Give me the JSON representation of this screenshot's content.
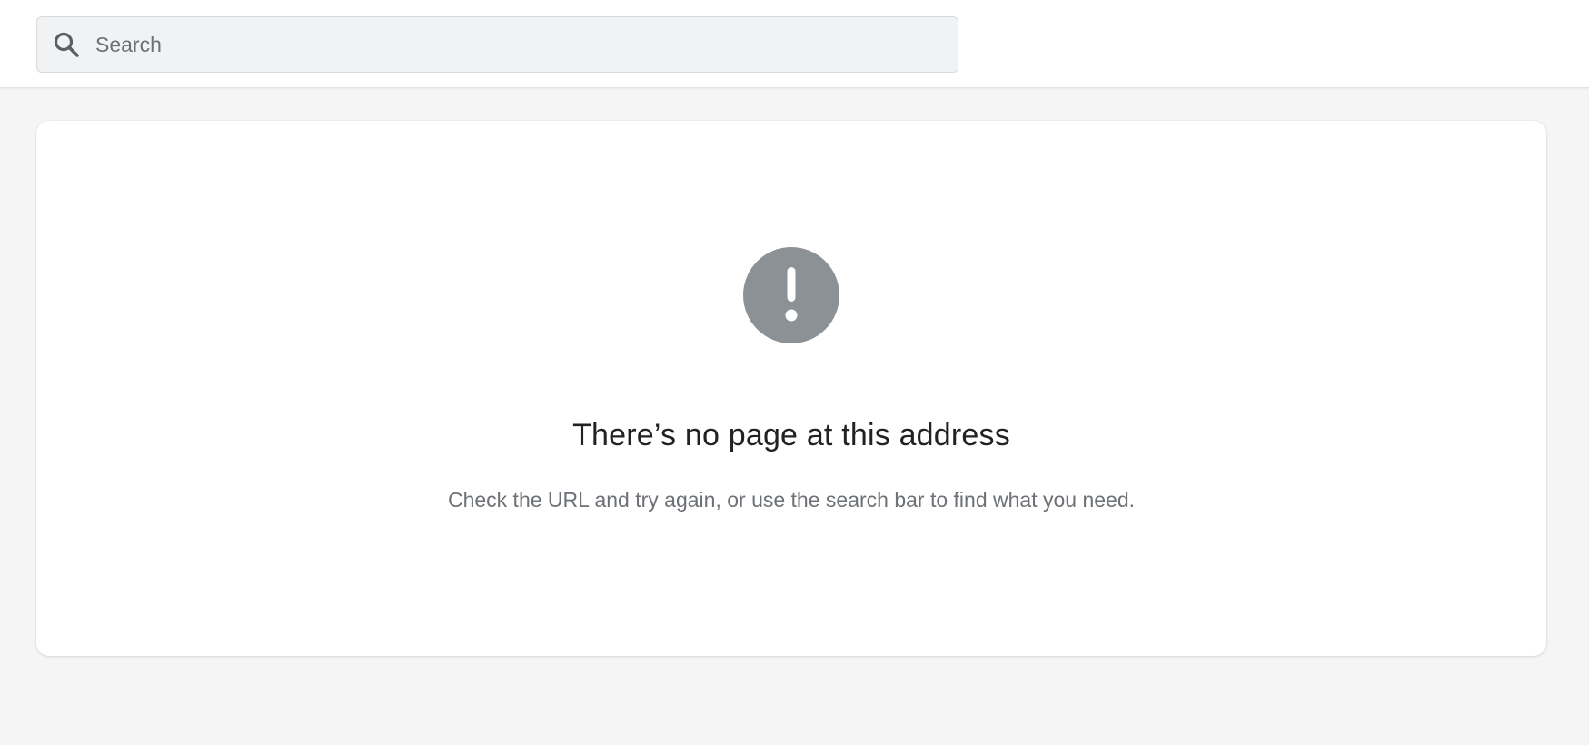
{
  "search": {
    "placeholder": "Search",
    "icon": "search-icon"
  },
  "error": {
    "icon": "exclamation-circle-icon",
    "icon_color": "#8c9196",
    "title": "There’s no page at this address",
    "message": "Check the URL and try again, or use the search bar to find what you need."
  },
  "colors": {
    "background": "#f5f5f5",
    "surface": "#ffffff",
    "search_bg": "#f1f2f3",
    "text_primary": "#202223",
    "text_subdued": "#6d7175"
  }
}
